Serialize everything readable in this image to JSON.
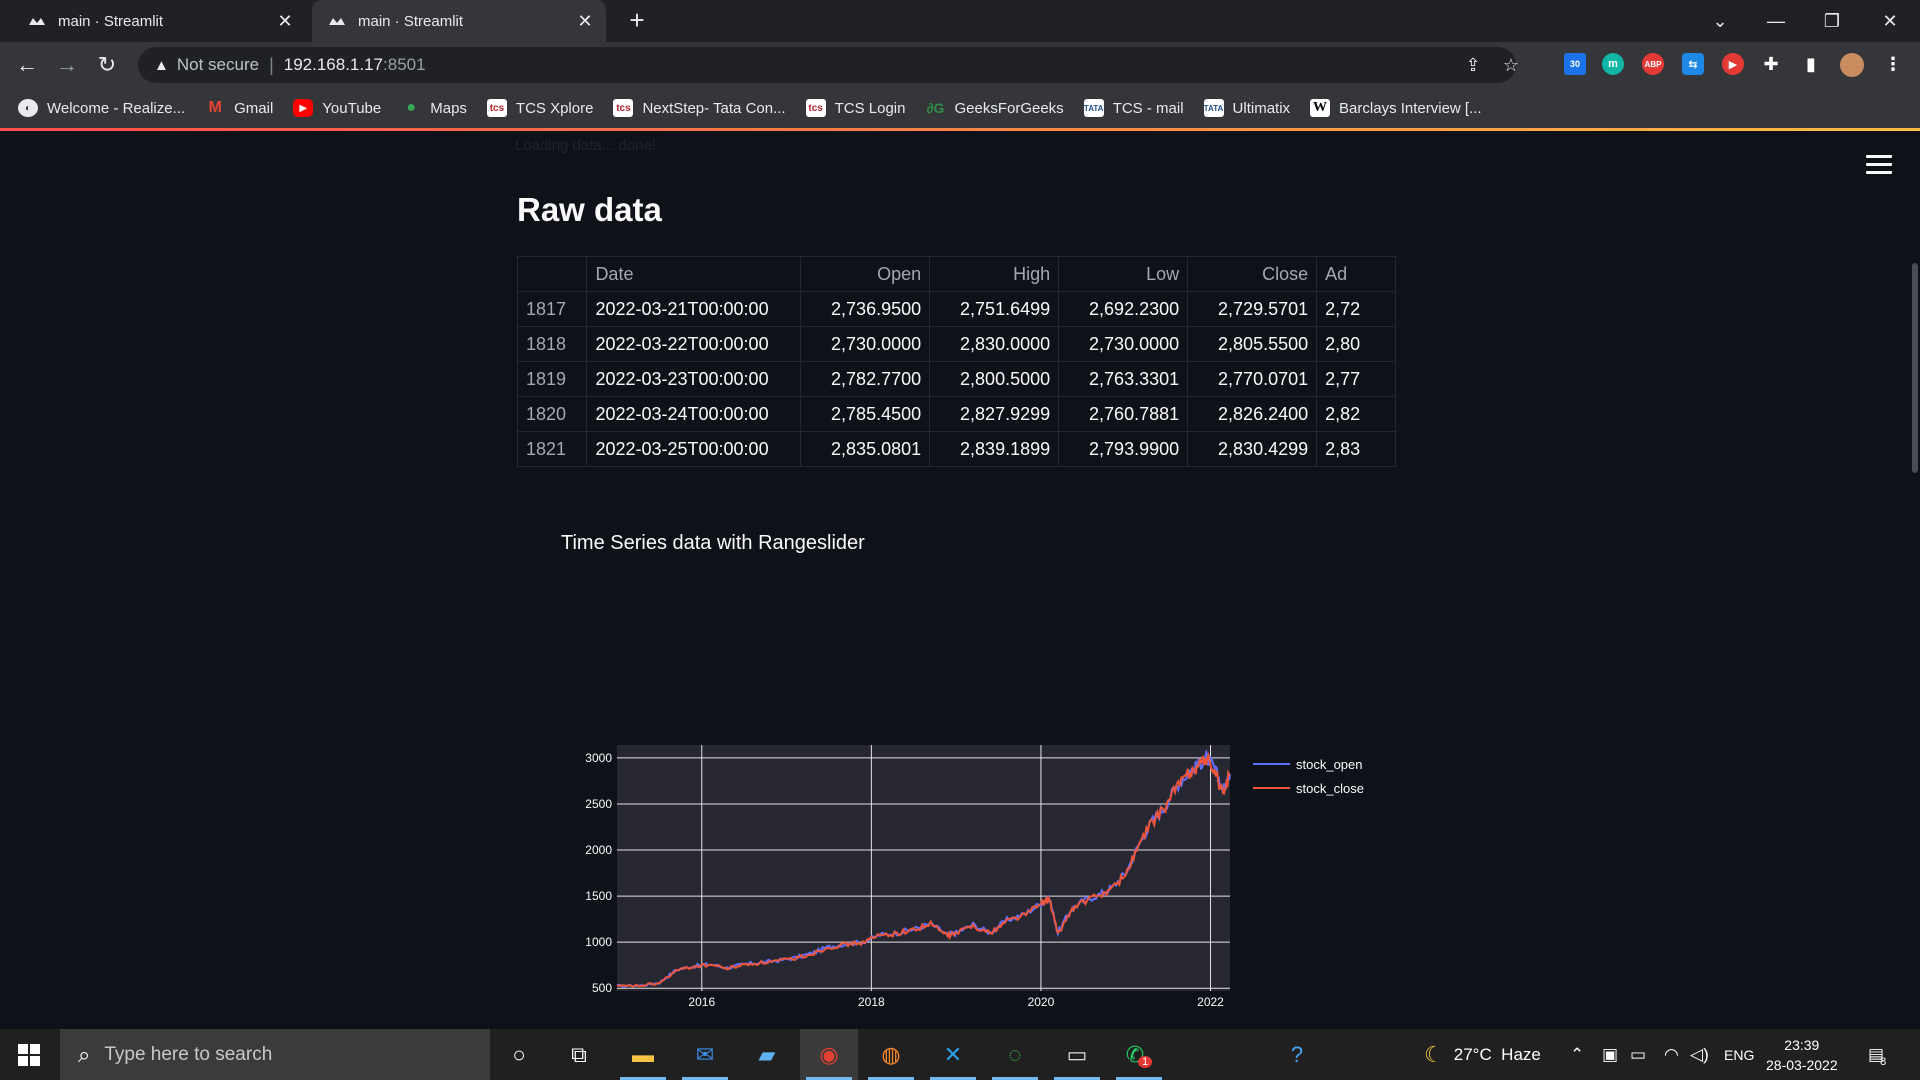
{
  "browser": {
    "tabs": [
      {
        "title": "main · Streamlit",
        "active": false
      },
      {
        "title": "main · Streamlit",
        "active": true
      }
    ],
    "address": {
      "security": "Not secure",
      "host": "192.168.1.17",
      "port": ":8501"
    },
    "extensions": {
      "badge_count": "30",
      "abp_label": "ABP",
      "m_label": "m"
    },
    "bookmarks": [
      {
        "label": "Welcome - Realize...",
        "icon": "globe-icon"
      },
      {
        "label": "Gmail",
        "icon": "gmail-icon"
      },
      {
        "label": "YouTube",
        "icon": "youtube-icon"
      },
      {
        "label": "Maps",
        "icon": "maps-icon"
      },
      {
        "label": "TCS Xplore",
        "icon": "tcs-icon"
      },
      {
        "label": "NextStep- Tata Con...",
        "icon": "tcs-icon"
      },
      {
        "label": "TCS Login",
        "icon": "tcs-icon"
      },
      {
        "label": "GeeksForGeeks",
        "icon": "gfg-icon"
      },
      {
        "label": "TCS - mail",
        "icon": "tata-icon"
      },
      {
        "label": "Ultimatix",
        "icon": "tata-icon"
      },
      {
        "label": "Barclays Interview [...",
        "icon": "wikipedia-icon"
      }
    ]
  },
  "page": {
    "ghost_text": "Loading data... done!",
    "section_title": "Raw data",
    "table": {
      "columns": [
        "",
        "Date",
        "Open",
        "High",
        "Low",
        "Close",
        "Ad"
      ],
      "rows": [
        {
          "idx": "1817",
          "date": "2022-03-21T00:00:00",
          "open": "2,736.9500",
          "high": "2,751.6499",
          "low": "2,692.2300",
          "close": "2,729.5701",
          "adj": "2,72"
        },
        {
          "idx": "1818",
          "date": "2022-03-22T00:00:00",
          "open": "2,730.0000",
          "high": "2,830.0000",
          "low": "2,730.0000",
          "close": "2,805.5500",
          "adj": "2,80"
        },
        {
          "idx": "1819",
          "date": "2022-03-23T00:00:00",
          "open": "2,782.7700",
          "high": "2,800.5000",
          "low": "2,763.3301",
          "close": "2,770.0701",
          "adj": "2,77"
        },
        {
          "idx": "1820",
          "date": "2022-03-24T00:00:00",
          "open": "2,785.4500",
          "high": "2,827.9299",
          "low": "2,760.7881",
          "close": "2,826.2400",
          "adj": "2,82"
        },
        {
          "idx": "1821",
          "date": "2022-03-25T00:00:00",
          "open": "2,835.0801",
          "high": "2,839.1899",
          "low": "2,793.9900",
          "close": "2,830.4299",
          "adj": "2,83"
        }
      ]
    }
  },
  "chart_data": {
    "type": "line",
    "title": "Time Series data with Rangeslider",
    "xlabel": "",
    "ylabel": "",
    "x_ticks": [
      "2016",
      "2018",
      "2020",
      "2022"
    ],
    "y_ticks": [
      "500",
      "1000",
      "1500",
      "2000",
      "2500",
      "3000"
    ],
    "xlim": [
      2015.0,
      2022.23
    ],
    "ylim": [
      470,
      3140
    ],
    "grid": true,
    "legend": "right",
    "rangeslider": true,
    "x": [
      2015.0,
      2015.3,
      2015.5,
      2015.7,
      2015.9,
      2016.1,
      2016.3,
      2016.5,
      2016.7,
      2016.9,
      2017.1,
      2017.3,
      2017.5,
      2017.7,
      2017.9,
      2018.1,
      2018.3,
      2018.5,
      2018.7,
      2018.9,
      2019.0,
      2019.2,
      2019.4,
      2019.6,
      2019.8,
      2020.0,
      2020.1,
      2020.2,
      2020.35,
      2020.5,
      2020.7,
      2020.85,
      2021.0,
      2021.15,
      2021.3,
      2021.45,
      2021.6,
      2021.75,
      2021.85,
      2021.95,
      2022.05,
      2022.15,
      2022.23
    ],
    "series": [
      {
        "name": "stock_open",
        "color": "#636efa",
        "values": [
          525,
          530,
          560,
          700,
          740,
          760,
          720,
          760,
          780,
          800,
          830,
          880,
          950,
          980,
          1000,
          1080,
          1100,
          1140,
          1200,
          1080,
          1100,
          1190,
          1100,
          1240,
          1300,
          1420,
          1480,
          1100,
          1350,
          1450,
          1520,
          1600,
          1750,
          2050,
          2300,
          2450,
          2700,
          2850,
          2920,
          3000,
          2880,
          2650,
          2820
        ]
      },
      {
        "name": "stock_close",
        "color": "#ef553b",
        "values": [
          520,
          528,
          555,
          690,
          735,
          755,
          715,
          755,
          775,
          795,
          825,
          875,
          945,
          975,
          995,
          1075,
          1095,
          1135,
          1195,
          1070,
          1095,
          1185,
          1095,
          1235,
          1295,
          1415,
          1470,
          1080,
          1340,
          1440,
          1510,
          1590,
          1740,
          2040,
          2290,
          2440,
          2690,
          2840,
          2910,
          2990,
          2860,
          2600,
          2830
        ]
      }
    ]
  },
  "taskbar": {
    "search_placeholder": "Type here to search",
    "weather": "27°C  Haze",
    "language": "ENG",
    "time": "23:39",
    "date": "28-03-2022",
    "whatsapp_badge": "1",
    "notification_count": "8"
  }
}
